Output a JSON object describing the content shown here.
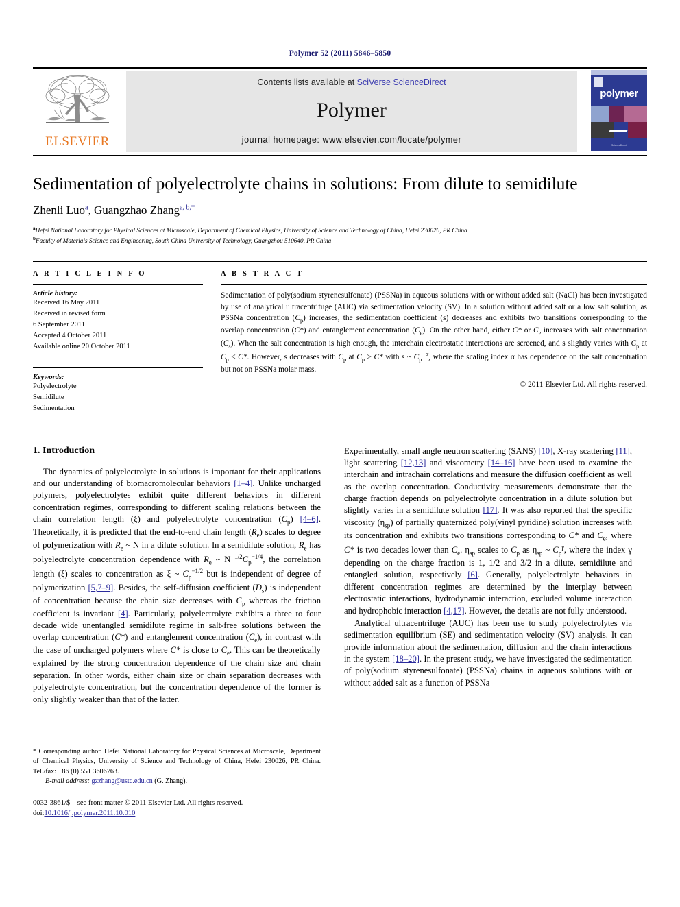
{
  "running_head": "Polymer 52 (2011) 5846–5850",
  "masthead": {
    "publisher_wordmark": "ELSEVIER",
    "contents_prefix": "Contents lists available at ",
    "contents_link": "SciVerse ScienceDirect",
    "journal_title": "Polymer",
    "homepage": "journal homepage: www.elsevier.com/locate/polymer",
    "cover_title": "polymer",
    "cover_footer": "ScienceDirect"
  },
  "article": {
    "title": "Sedimentation of polyelectrolyte chains in solutions: From dilute to semidilute",
    "authors_plain": "Zhenli Luo a, Guangzhao Zhang a, b,*",
    "author1": "Zhenli Luo",
    "author1_marks": "a",
    "author2": "Guangzhao Zhang",
    "author2_marks": "a, b,*",
    "affiliation_a_mark": "a",
    "affiliation_a": "Hefei National Laboratory for Physical Sciences at Microscale, Department of Chemical Physics, University of Science and Technology of China, Hefei 230026, PR China",
    "affiliation_b_mark": "b",
    "affiliation_b": "Faculty of Materials Science and Engineering, South China University of Technology, Guangzhou 510640, PR China"
  },
  "info": {
    "heading": "A R T I C L E   I N F O",
    "history_label": "Article history:",
    "history": [
      "Received 16 May 2011",
      "Received in revised form",
      "6 September 2011",
      "Accepted 4 October 2011",
      "Available online 20 October 2011"
    ],
    "keywords_label": "Keywords:",
    "keywords": [
      "Polyelectrolyte",
      "Semidilute",
      "Sedimentation"
    ]
  },
  "abstract": {
    "heading": "A B S T R A C T",
    "text_1": "Sedimentation of poly(sodium styrenesulfonate) (PSSNa) in aqueous solutions with or without added salt (NaCl) has been investigated by use of analytical ultracentrifuge (AUC) via sedimentation velocity (SV). In a solution without added salt or a low salt solution, as PSSNa concentration (",
    "cp_1": "C",
    "cp_1_sub": "p",
    "text_2": ") increases, the sedimentation coefficient (s) decreases and exhibits two transitions corresponding to the overlap concentration (",
    "cstar_1": "C*",
    "text_3": ") and entanglement concentration (",
    "ce_1": "C",
    "ce_1_sub": "e",
    "text_4": "). On the other hand, either ",
    "cstar_2": "C*",
    "text_5": " or ",
    "ce_2": "C",
    "ce_2_sub": "e",
    "text_6": " increases with salt concentration (",
    "cs_1": "C",
    "cs_1_sub": "s",
    "text_7": "). When the salt concentration is high enough, the interchain electrostatic interactions are screened, and s slightly varies with ",
    "cp_2": "C",
    "cp_2_sub": "p",
    "text_8": " at ",
    "cp_3": "C",
    "cp_3_sub": "p",
    "text_9": " < ",
    "cstar_3": "C*",
    "text_10": ". However, s decreases with ",
    "cp_4": "C",
    "cp_4_sub": "p",
    "text_11": " at ",
    "cp_5": "C",
    "cp_5_sub": "p",
    "text_12": " > ",
    "cstar_4": "C*",
    "text_13": " with s ~ ",
    "cp_6": "C",
    "cp_6_sub": "p",
    "cp_6_sup": "−α",
    "text_14": ", where the scaling index α has dependence on the salt concentration but not on PSSNa molar mass.",
    "copyright": "© 2011 Elsevier Ltd. All rights reserved."
  },
  "intro": {
    "heading": "1.  Introduction",
    "p1_a": "The dynamics of polyelectrolyte in solutions is important for their applications and our understanding of biomacromolecular behaviors ",
    "p1_ref1": "[1–4]",
    "p1_b": ". Unlike uncharged polymers, polyelectrolytes exhibit quite different behaviors in different concentration regimes, corresponding to different scaling relations between the chain correlation length (ξ) and polyelectrolyte concentration (",
    "p1_cp": "C",
    "p1_cp_sub": "p",
    "p1_c": ") ",
    "p1_ref2": "[4–6]",
    "p1_d": ". Theoretically, it is predicted that the end-to-end chain length (",
    "p1_re": "R",
    "p1_re_sub": "e",
    "p1_e": ") scales to degree of polymerization with ",
    "p1_re2": "R",
    "p1_re2_sub": "e",
    "p1_f": " ~ N in a dilute solution. In a semidilute solution, ",
    "p1_re3": "R",
    "p1_re3_sub": "e",
    "p1_g": " has polyelectrolyte concentration dependence with ",
    "p1_re4": "R",
    "p1_re4_sub": "e",
    "p1_h": " ~ N ",
    "p1_exp1": "1/2",
    "p1_cp2": "C",
    "p1_cp2_sub": "p",
    "p1_cp2_sup": "−1/4",
    "p1_i": ", the correlation length (ξ) scales to concentration as ξ ~ ",
    "p1_cp3": "C",
    "p1_cp3_sub": "p",
    "p1_cp3_sup": "−1/2",
    "p1_j": " but is independent of degree of polymerization ",
    "p1_ref3": "[5,7–9]",
    "p1_k": ". Besides, the self-diffusion coefficient (",
    "p1_ds": "D",
    "p1_ds_sub": "s",
    "p1_l": ") is independent of concentration because the chain size decreases with ",
    "p1_cp4": "C",
    "p1_cp4_sub": "p",
    "p1_m": " whereas the friction coefficient is invariant ",
    "p1_ref4": "[4]",
    "p1_n": ". Particularly, polyelectrolyte exhibits a three to four decade wide unentangled semidilute regime in salt-free solutions between the overlap concentration (",
    "p1_cstar": "C*",
    "p1_o": ") and entanglement concentration (",
    "p1_ce": "C",
    "p1_ce_sub": "e",
    "p1_p": "), in contrast with the case of uncharged polymers where ",
    "p1_cstar2": "C*",
    "p1_q": " is close to ",
    "p1_ce2": "C",
    "p1_ce2_sub": "e",
    "p1_r": ". This can be theoretically explained by the strong concentration dependence of the chain size and chain separation. In other words, either chain size or chain separation decreases with polyelectrolyte concentration, but the concentration dependence of the former is only slightly weaker than that of the latter.",
    "p2_a": "Experimentally, small angle neutron scattering (SANS) ",
    "p2_ref1": "[10]",
    "p2_b": ", X-ray scattering ",
    "p2_ref2": "[11]",
    "p2_c": ", light scattering ",
    "p2_ref3": "[12,13]",
    "p2_d": " and viscometry ",
    "p2_ref4": "[14–16]",
    "p2_e": " have been used to examine the interchain and intrachain correlations and measure the diffusion coefficient as well as the overlap concentration. Conductivity measurements demonstrate that the charge fraction depends on polyelectrolyte concentration in a dilute solution but slightly varies in a semidilute solution ",
    "p2_ref5": "[17]",
    "p2_f": ". It was also reported that the specific viscosity (η",
    "p2_eta_sub": "sp",
    "p2_g": ") of partially quaternized poly(vinyl pyridine) solution increases with its concentration and exhibits two transitions corresponding to ",
    "p2_cstar": "C*",
    "p2_h": " and ",
    "p2_ce": "C",
    "p2_ce_sub": "e",
    "p2_i": ", where ",
    "p2_cstar2": "C*",
    "p2_j": " is two decades lower than ",
    "p2_ce2": "C",
    "p2_ce2_sub": "e",
    "p2_k": ". η",
    "p2_eta2_sub": "sp",
    "p2_l": " scales to ",
    "p2_cp": "C",
    "p2_cp_sub": "p",
    "p2_m": " as η",
    "p2_eta3_sub": "sp",
    "p2_n": " ~ ",
    "p2_cp2": "C",
    "p2_cp2_sub": "p",
    "p2_cp2_sup": "γ",
    "p2_o": ", where the index γ depending on the charge fraction is 1, 1/2 and 3/2 in a dilute, semidilute and entangled solution, respectively ",
    "p2_ref6": "[6]",
    "p2_p": ". Generally, polyelectrolyte behaviors in different concentration regimes are determined by the interplay between electrostatic interactions, hydrodynamic interaction, excluded volume interaction and hydrophobic interaction ",
    "p2_ref7": "[4,17]",
    "p2_q": ". However, the details are not fully understood.",
    "p3_a": "Analytical ultracentrifuge (AUC) has been use to study polyelectrolytes via sedimentation equilibrium (SE) and sedimentation velocity (SV) analysis. It can provide information about the sedimentation, diffusion and the chain interactions in the system ",
    "p3_ref1": "[18–20]",
    "p3_b": ". In the present study, we have investigated the sedimentation of poly(sodium styrenesulfonate) (PSSNa) chains in aqueous solutions with or without added salt as a function of PSSNa"
  },
  "footnotes": {
    "corresponding": "* Corresponding author. Hefei National Laboratory for Physical Sciences at Microscale, Department of Chemical Physics, University of Science and Technology of China, Hefei 230026, PR China. Tel./fax: +86 (0) 551 3606763.",
    "email_label": "E-mail address:",
    "email": "gzzhang@ustc.edu.cn",
    "email_suffix": " (G. Zhang).",
    "imprint": "0032-3861/$ – see front matter © 2011 Elsevier Ltd. All rights reserved.",
    "doi_label": "doi:",
    "doi": "10.1016/j.polymer.2011.10.010"
  },
  "colors": {
    "link": "#2a2a9c",
    "elsevier_orange": "#e87722",
    "cover_blue": "#2c3a92",
    "band_gray": "#e6e6e6"
  }
}
